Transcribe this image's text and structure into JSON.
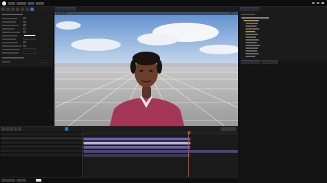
{
  "colors": {
    "accent": "#2a76c6",
    "playhead": "#d04040",
    "track_purple": "#6b5fb0",
    "track_light": "#b9b2d8"
  },
  "icons": [
    "unreal-logo-icon",
    "save-icon",
    "play-icon",
    "camera-icon"
  ],
  "sequencer": {
    "playhead_position_fraction": 0.68
  }
}
